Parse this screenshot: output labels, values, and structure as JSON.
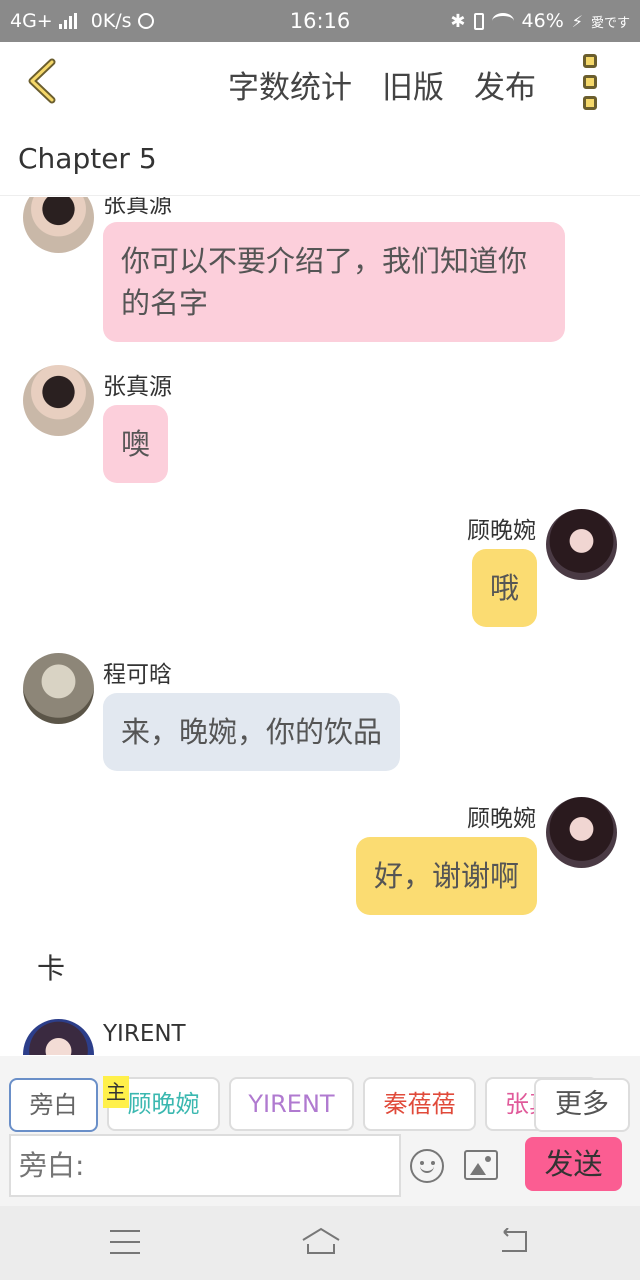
{
  "status_bar": {
    "network": "4G+",
    "speed": "0K/s",
    "time": "16:16",
    "battery": "46%",
    "carrier_tag": "愛です"
  },
  "header": {
    "back_icon": "chevron-left-icon",
    "links": [
      "字数统计",
      "旧版",
      "发布"
    ],
    "menu_icon": "three-dots-vertical-icon",
    "accent_color": "#f5d86a"
  },
  "chapter": {
    "title": "Chapter 5"
  },
  "messages": [
    {
      "speaker": "张真源",
      "side": "left",
      "text": "你可以不要介绍了，我们知道你的名字",
      "color": "#fccfdb"
    },
    {
      "speaker": "张真源",
      "side": "left",
      "text": "噢",
      "color": "#fccfdb"
    },
    {
      "speaker": "顾晚婉",
      "side": "right",
      "text": "哦",
      "color": "#fbdc72"
    },
    {
      "speaker": "程可晗",
      "side": "left",
      "text": "来，晚婉，你的饮品",
      "color": "#e2e8f0"
    },
    {
      "speaker": "顾晚婉",
      "side": "right",
      "text": "好，谢谢啊",
      "color": "#fbdc72"
    },
    {
      "narration": "卡"
    },
    {
      "speaker": "YIRENT",
      "side": "left"
    }
  ],
  "characters": [
    {
      "label": "旁白",
      "color": "#666666",
      "selected": true
    },
    {
      "label": "顾晚婉",
      "color": "#3bb8b0",
      "tag": "主"
    },
    {
      "label": "YIRENT",
      "color": "#b07ad0"
    },
    {
      "label": "秦蓓蓓",
      "color": "#e04a3a"
    },
    {
      "label": "张真源",
      "color": "#e05a9a"
    }
  ],
  "more_label": "更多",
  "input": {
    "placeholder": "旁白:"
  },
  "send_label": "发送",
  "send_color": "#fb5d92"
}
